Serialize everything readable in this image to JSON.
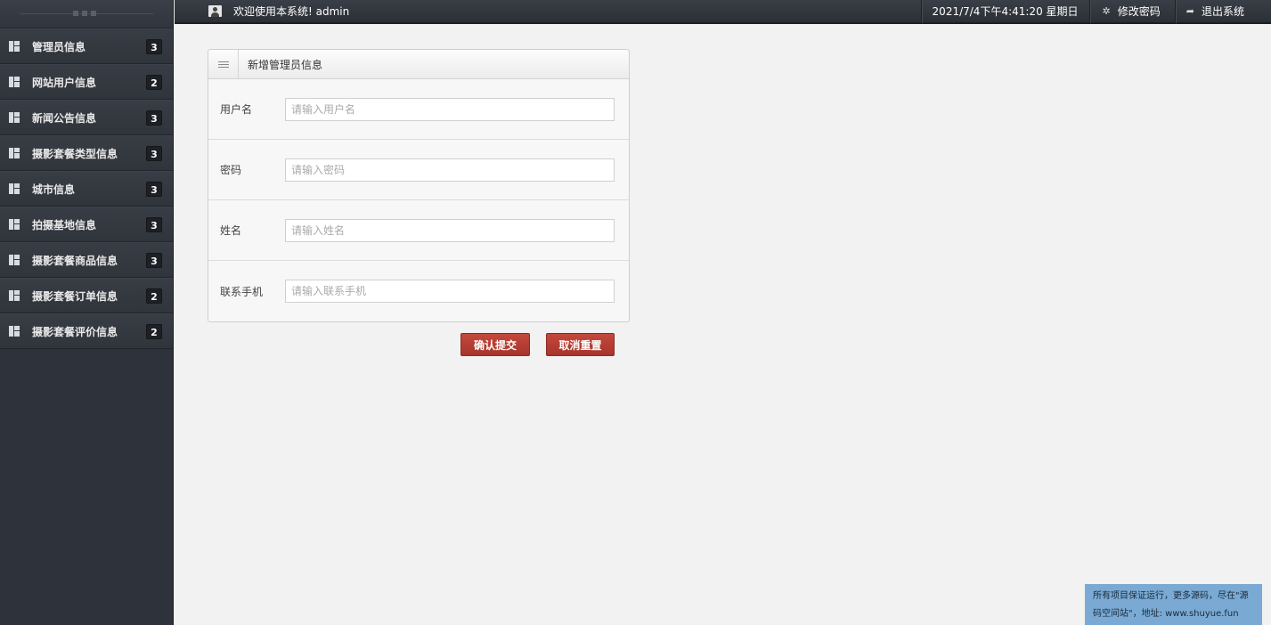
{
  "sidebar": {
    "items": [
      {
        "label": "管理员信息",
        "badge": "3"
      },
      {
        "label": "网站用户信息",
        "badge": "2"
      },
      {
        "label": "新闻公告信息",
        "badge": "3"
      },
      {
        "label": "摄影套餐类型信息",
        "badge": "3"
      },
      {
        "label": "城市信息",
        "badge": "3"
      },
      {
        "label": "拍摄基地信息",
        "badge": "3"
      },
      {
        "label": "摄影套餐商品信息",
        "badge": "3"
      },
      {
        "label": "摄影套餐订单信息",
        "badge": "2"
      },
      {
        "label": "摄影套餐评价信息",
        "badge": "2"
      }
    ]
  },
  "topbar": {
    "welcome": "欢迎使用本系统! admin",
    "datetime": "2021/7/4下午4:41:20 星期日",
    "change_password": "修改密码",
    "logout": "退出系统"
  },
  "panel": {
    "title": "新增管理员信息",
    "fields": [
      {
        "label": "用户名",
        "placeholder": "请输入用户名",
        "value": ""
      },
      {
        "label": "密码",
        "placeholder": "请输入密码",
        "value": ""
      },
      {
        "label": "姓名",
        "placeholder": "请输入姓名",
        "value": ""
      },
      {
        "label": "联系手机",
        "placeholder": "请输入联系手机",
        "value": ""
      }
    ]
  },
  "buttons": {
    "submit": "确认提交",
    "reset": "取消重置"
  },
  "notice": {
    "text": "所有项目保证运行，更多源码，尽在\"源码空间站\"，地址: www.shuyue.fun"
  }
}
